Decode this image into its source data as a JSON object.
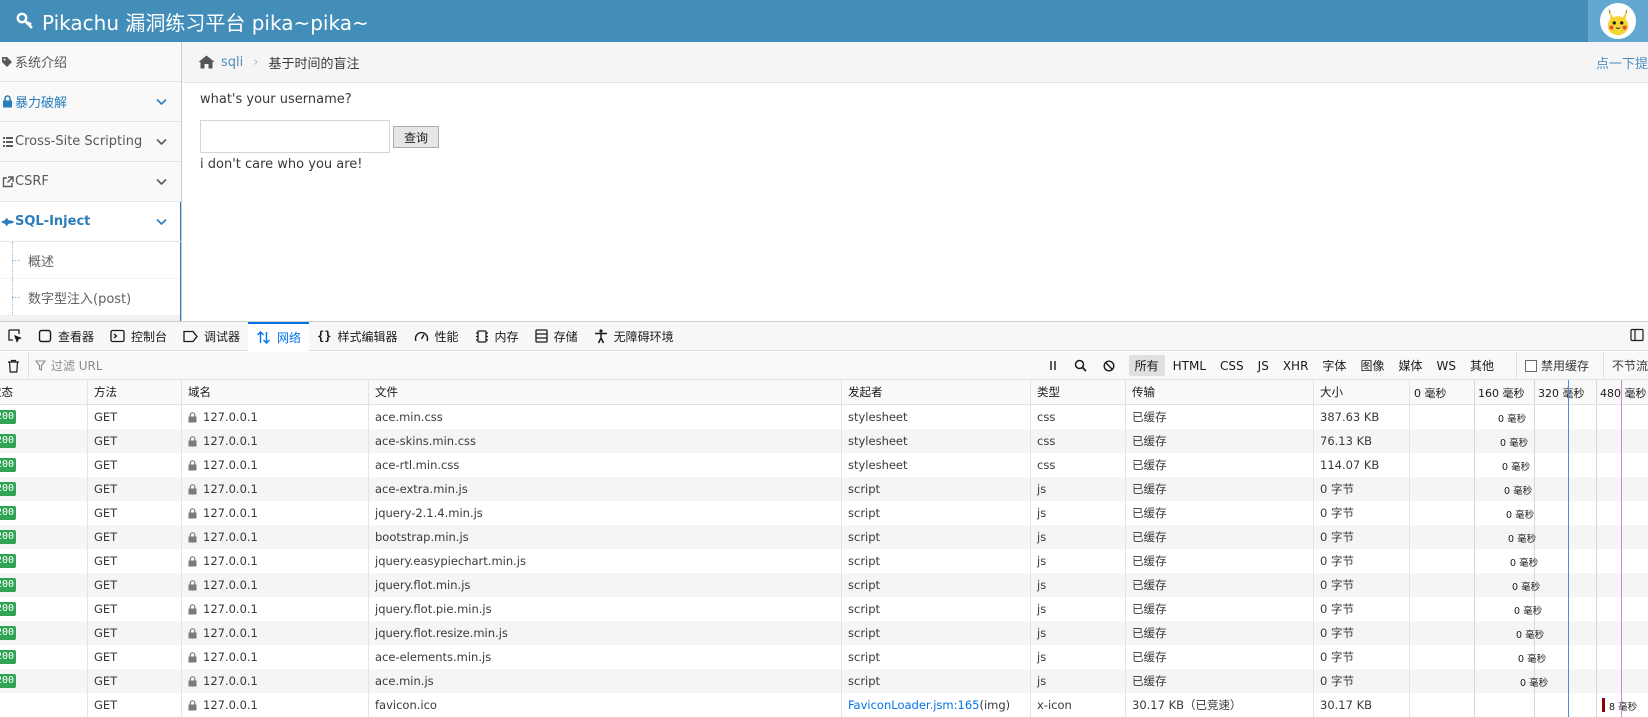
{
  "navbar": {
    "brand": "Pikachu 漏洞练习平台 pika~pika~"
  },
  "sidebar": {
    "items": [
      {
        "label": "系统介绍",
        "icon": "tags-icon"
      },
      {
        "label": "暴力破解",
        "icon": "lock-icon"
      },
      {
        "label": "Cross-Site Scripting",
        "icon": "list-icon"
      },
      {
        "label": "CSRF",
        "icon": "external-link-icon"
      },
      {
        "label": "SQL-Inject",
        "icon": "fighter-jet-icon"
      }
    ],
    "subitems": [
      {
        "label": "概述"
      },
      {
        "label": "数字型注入(post)"
      }
    ]
  },
  "breadcrumb": {
    "link": "sqli",
    "current": "基于时间的盲注",
    "right_link": "点一下提"
  },
  "content": {
    "question": "what's your username?",
    "username_value": "",
    "query_button": "查询",
    "message": "i don't care who you are!"
  },
  "devtools": {
    "tabs": [
      {
        "label": "查看器",
        "icon": "inspector-icon"
      },
      {
        "label": "控制台",
        "icon": "console-icon"
      },
      {
        "label": "调试器",
        "icon": "debugger-icon"
      },
      {
        "label": "网络",
        "icon": "network-icon",
        "selected": true
      },
      {
        "label": "样式编辑器",
        "icon": "braces-icon"
      },
      {
        "label": "性能",
        "icon": "gauge-icon"
      },
      {
        "label": "内存",
        "icon": "memory-icon"
      },
      {
        "label": "存储",
        "icon": "storage-icon"
      },
      {
        "label": "无障碍环境",
        "icon": "accessibility-icon"
      }
    ],
    "filter_placeholder": "过滤 URL",
    "type_filters": [
      "所有",
      "HTML",
      "CSS",
      "JS",
      "XHR",
      "字体",
      "图像",
      "媒体",
      "WS",
      "其他"
    ],
    "disable_cache_label": "禁用缓存",
    "throttle_label": "不节流",
    "columns": [
      "状态",
      "方法",
      "域名",
      "文件",
      "发起者",
      "类型",
      "传输",
      "大小"
    ],
    "waterfall_ticks": [
      "0 毫秒",
      "160 毫秒",
      "320 毫秒",
      "480 毫秒"
    ],
    "requests": [
      {
        "status": "200",
        "method": "GET",
        "domain": "127.0.0.1",
        "file": "ace.min.css",
        "initiator": "stylesheet",
        "type": "css",
        "transferred": "已缓存",
        "size": "387.63 KB",
        "time": "0 毫秒"
      },
      {
        "status": "200",
        "method": "GET",
        "domain": "127.0.0.1",
        "file": "ace-skins.min.css",
        "initiator": "stylesheet",
        "type": "css",
        "transferred": "已缓存",
        "size": "76.13 KB",
        "time": "0 毫秒"
      },
      {
        "status": "200",
        "method": "GET",
        "domain": "127.0.0.1",
        "file": "ace-rtl.min.css",
        "initiator": "stylesheet",
        "type": "css",
        "transferred": "已缓存",
        "size": "114.07 KB",
        "time": "0 毫秒"
      },
      {
        "status": "200",
        "method": "GET",
        "domain": "127.0.0.1",
        "file": "ace-extra.min.js",
        "initiator": "script",
        "type": "js",
        "transferred": "已缓存",
        "size": "0 字节",
        "time": "0 毫秒"
      },
      {
        "status": "200",
        "method": "GET",
        "domain": "127.0.0.1",
        "file": "jquery-2.1.4.min.js",
        "initiator": "script",
        "type": "js",
        "transferred": "已缓存",
        "size": "0 字节",
        "time": "0 毫秒"
      },
      {
        "status": "200",
        "method": "GET",
        "domain": "127.0.0.1",
        "file": "bootstrap.min.js",
        "initiator": "script",
        "type": "js",
        "transferred": "已缓存",
        "size": "0 字节",
        "time": "0 毫秒"
      },
      {
        "status": "200",
        "method": "GET",
        "domain": "127.0.0.1",
        "file": "jquery.easypiechart.min.js",
        "initiator": "script",
        "type": "js",
        "transferred": "已缓存",
        "size": "0 字节",
        "time": "0 毫秒"
      },
      {
        "status": "200",
        "method": "GET",
        "domain": "127.0.0.1",
        "file": "jquery.flot.min.js",
        "initiator": "script",
        "type": "js",
        "transferred": "已缓存",
        "size": "0 字节",
        "time": "0 毫秒"
      },
      {
        "status": "200",
        "method": "GET",
        "domain": "127.0.0.1",
        "file": "jquery.flot.pie.min.js",
        "initiator": "script",
        "type": "js",
        "transferred": "已缓存",
        "size": "0 字节",
        "time": "0 毫秒"
      },
      {
        "status": "200",
        "method": "GET",
        "domain": "127.0.0.1",
        "file": "jquery.flot.resize.min.js",
        "initiator": "script",
        "type": "js",
        "transferred": "已缓存",
        "size": "0 字节",
        "time": "0 毫秒"
      },
      {
        "status": "200",
        "method": "GET",
        "domain": "127.0.0.1",
        "file": "ace-elements.min.js",
        "initiator": "script",
        "type": "js",
        "transferred": "已缓存",
        "size": "0 字节",
        "time": "0 毫秒"
      },
      {
        "status": "200",
        "method": "GET",
        "domain": "127.0.0.1",
        "file": "ace.min.js",
        "initiator": "script",
        "type": "js",
        "transferred": "已缓存",
        "size": "0 字节",
        "time": "0 毫秒"
      },
      {
        "status": "",
        "method": "GET",
        "domain": "127.0.0.1",
        "file": "favicon.ico",
        "initiator": "FaviconLoader.jsm:165",
        "initiator_suffix": " (img)",
        "type": "x-icon",
        "transferred": "30.17 KB（已竞速）",
        "size": "30.17 KB",
        "time": "8 毫秒"
      }
    ]
  },
  "colors": {
    "navbar": "#438eb9",
    "accent": "#2b7dbc",
    "status_ok": "#31a354",
    "devtools_selected": "#0074e8"
  }
}
